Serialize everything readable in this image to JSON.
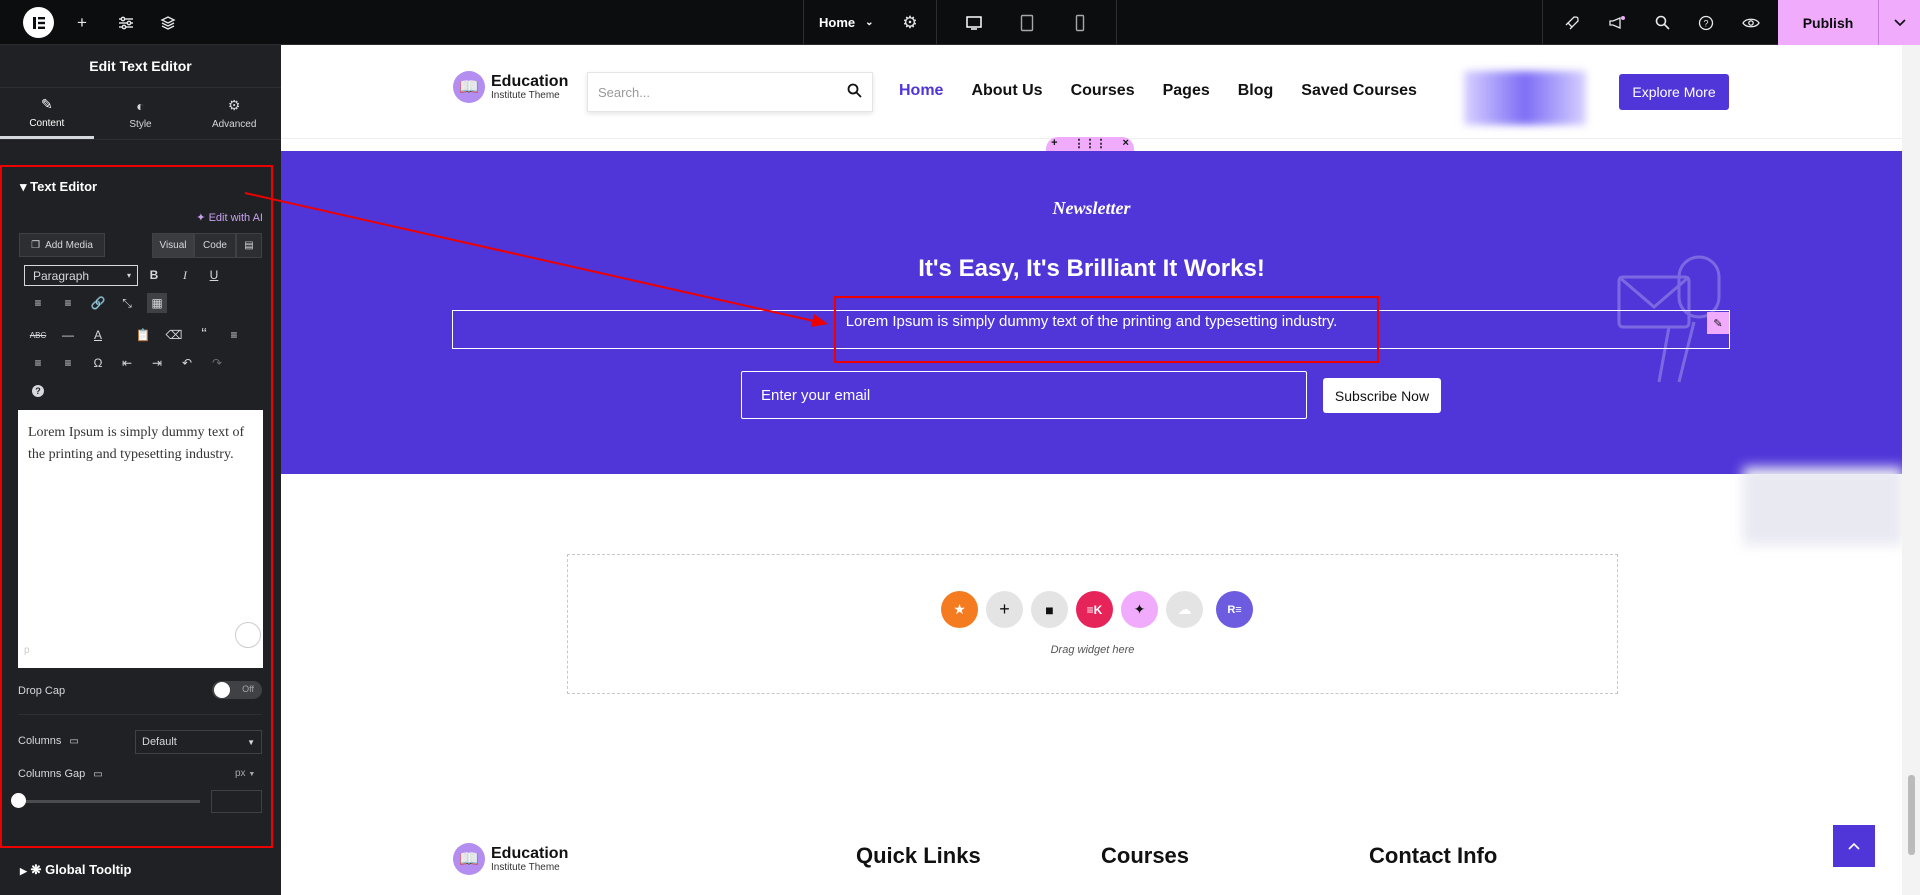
{
  "topbar": {
    "page_name": "Home",
    "publish_label": "Publish"
  },
  "panel": {
    "title": "Edit Text Editor",
    "tabs": [
      {
        "label": "Content"
      },
      {
        "label": "Style"
      },
      {
        "label": "Advanced"
      }
    ],
    "section_title": "Text Editor",
    "edit_with_ai": "Edit with AI",
    "add_media": "Add Media",
    "visual_tab": "Visual",
    "code_tab": "Code",
    "paragraph_select": "Paragraph",
    "editor_text": "Lorem Ipsum is simply dummy text of the printing and typesetting industry.",
    "editor_footer": "p",
    "drop_cap_label": "Drop Cap",
    "drop_cap_state": "Off",
    "columns_label": "Columns",
    "columns_value": "Default",
    "columns_gap_label": "Columns Gap",
    "columns_gap_unit": "px",
    "global_tooltip": "Global Tooltip"
  },
  "site": {
    "brand_name": "Education",
    "brand_sub": "Institute Theme",
    "search_placeholder": "Search...",
    "nav": [
      "Home",
      "About Us",
      "Courses",
      "Pages",
      "Blog",
      "Saved Courses"
    ],
    "explore_label": "Explore More"
  },
  "newsletter": {
    "eyebrow": "Newsletter",
    "title": "It's Easy, It's Brilliant It Works!",
    "text": "Lorem Ipsum is simply dummy text of the printing and typesetting industry.",
    "email_placeholder": "Enter your email",
    "subscribe_label": "Subscribe Now"
  },
  "dropzone": {
    "text": "Drag widget here"
  },
  "footer": {
    "brand_name": "Education",
    "brand_sub": "Institute Theme",
    "headings": [
      "Quick Links",
      "Courses",
      "Contact Info"
    ]
  },
  "colors": {
    "accent": "#5036d9",
    "publish": "#f0abfc",
    "panel_bg": "#1f2124",
    "highlight": "#ee0000"
  }
}
